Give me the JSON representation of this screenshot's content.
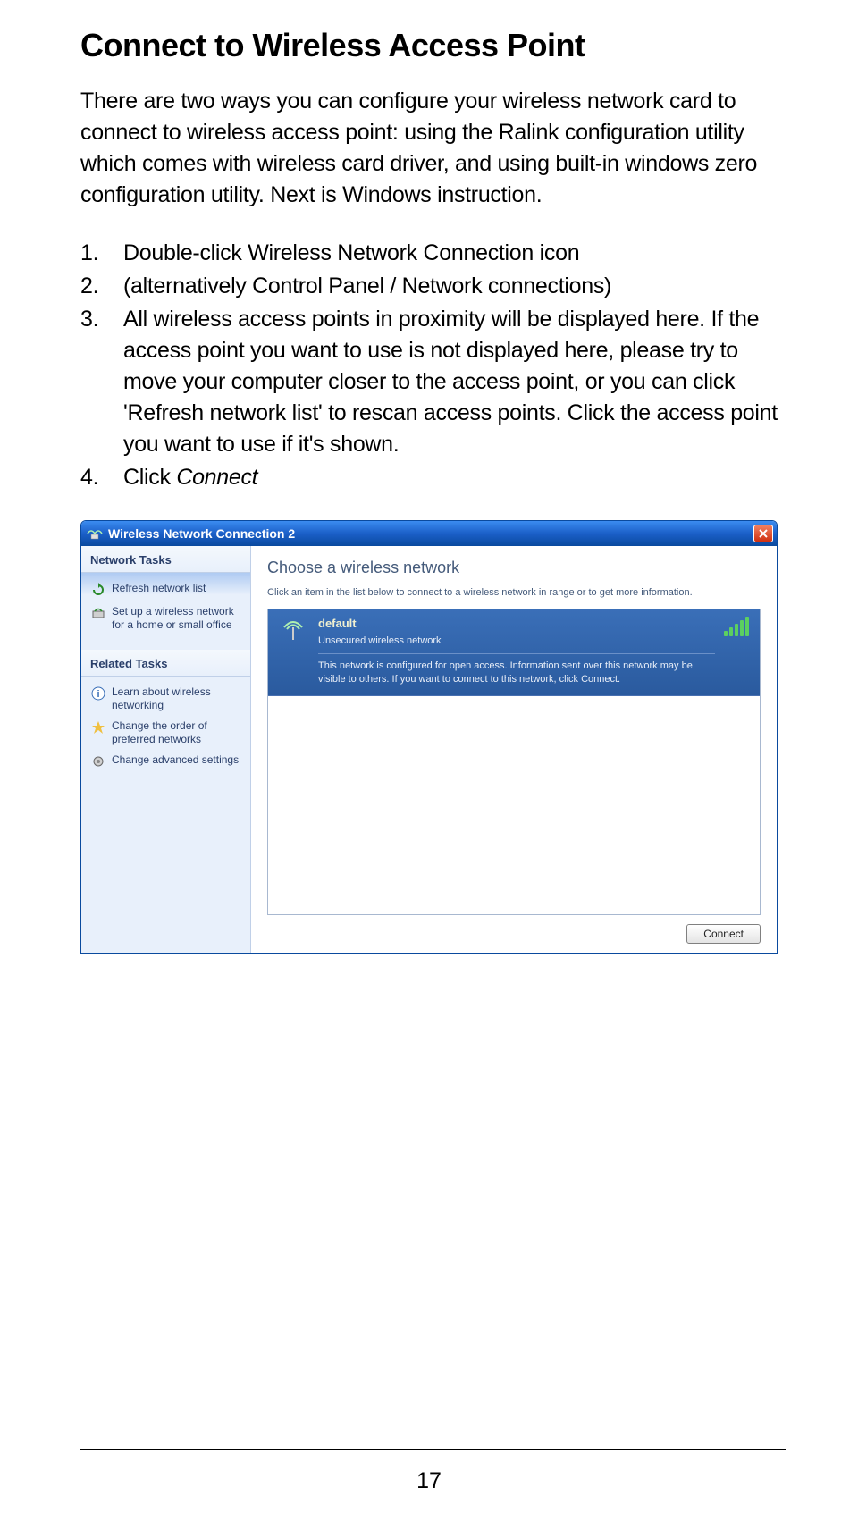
{
  "title": "Connect to Wireless Access Point",
  "intro": "There are two ways you can configure your wireless network card to connect to wireless access point: using the Ralink configuration utility which comes with wireless card driver, and using built-in windows zero configuration utility. Next is Windows instruction.",
  "steps": {
    "s1": "Double-click Wireless Network Connection icon",
    "s2": "(alternatively Control Panel / Network connections)",
    "s3": "All wireless access points in proximity will be displayed here. If the access point you want to use is not displayed here, please try to move your computer closer to the access point, or you can click 'Refresh network list' to rescan access points. Click the access point you want to use if it's shown.",
    "s4_prefix": "Click ",
    "s4_em": "Connect"
  },
  "window": {
    "title": "Wireless Network Connection 2",
    "sidebar": {
      "section1": "Network Tasks",
      "item1": "Refresh network list",
      "item2": "Set up a wireless network for a home or small office",
      "section2": "Related Tasks",
      "item3": "Learn about wireless networking",
      "item4": "Change the order of preferred networks",
      "item5": "Change advanced settings"
    },
    "main": {
      "heading": "Choose a wireless network",
      "instruction": "Click an item in the list below to connect to a wireless network in range or to get more information.",
      "net_name": "default",
      "net_sub": "Unsecured wireless network",
      "net_warn": "This network is configured for open access. Information sent over this network may be visible to others. If you want to connect to this network, click Connect.",
      "connect_btn": "Connect"
    }
  },
  "page_number": "17"
}
